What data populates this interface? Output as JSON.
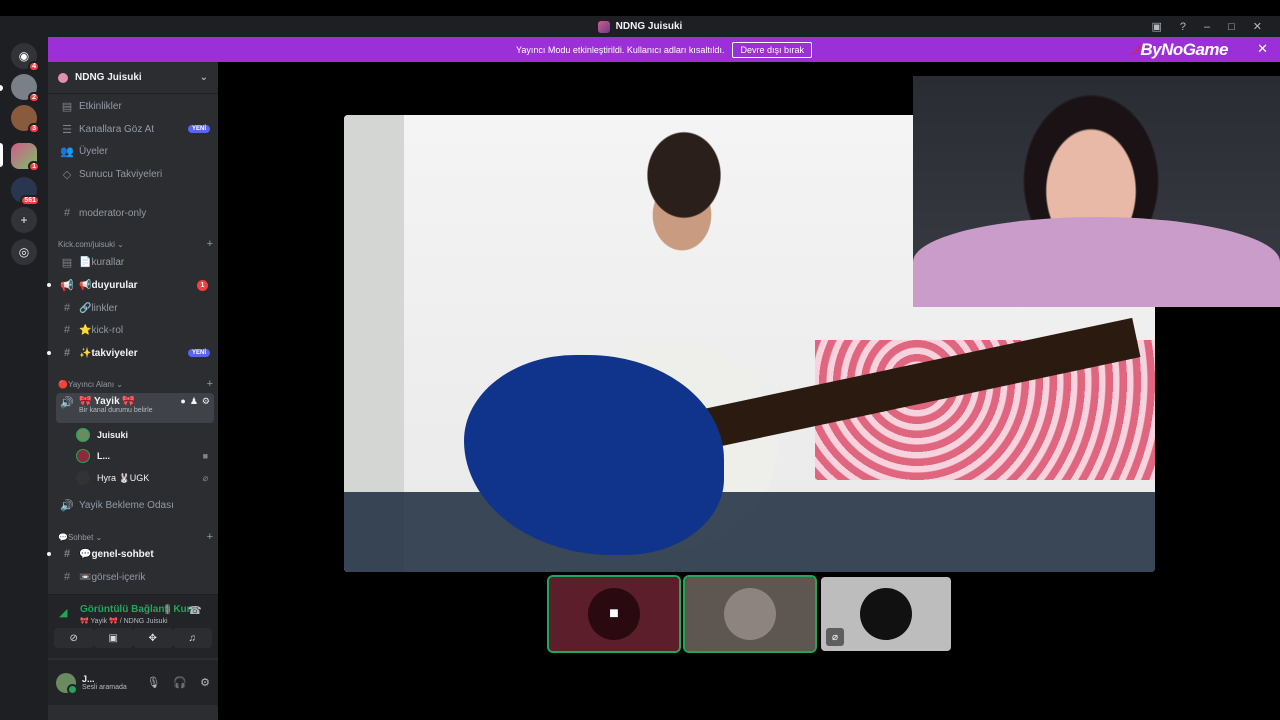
{
  "window": {
    "title": "NDNG Juisuki"
  },
  "banner": {
    "message": "Yayıncı Modu etkinleştirildi. Kullanıcı adları kısaltıldı.",
    "disable_label": "Devre dışı bırak",
    "brand": "ByNoGame"
  },
  "servers": {
    "badges": [
      "4",
      "2",
      "3",
      "1",
      "561"
    ]
  },
  "guild": {
    "name": "NDNG Juisuki",
    "top_items": [
      {
        "label": "Etkinlikler"
      },
      {
        "label": "Kanallara Göz At",
        "tag": "YENİ"
      },
      {
        "label": "Üyeler"
      },
      {
        "label": "Sunucu Takviyeleri"
      }
    ],
    "pinned_channel": "moderator-only",
    "categories": [
      {
        "name": "Kick.com/juisuki",
        "channels": [
          {
            "label": "📄kurallar"
          },
          {
            "label": "📢duyurular",
            "badge": "1"
          },
          {
            "label": "🔗linkler"
          },
          {
            "label": "⭐kick-rol"
          },
          {
            "label": "✨takviyeler",
            "tag": "YENİ"
          }
        ]
      },
      {
        "name": "🔴Yayıncı Alanı",
        "voice_channel": "🎀 Yayik 🎀",
        "voice_status": "Bir kanal durumu belirle",
        "voice_users": [
          "Juisuki",
          "L...",
          "Hyra 🐰UGK"
        ],
        "waiting_room": "Yayik Bekleme Odası"
      },
      {
        "name": "💬Sohbet",
        "channels": [
          {
            "label": "💬genel-sohbet"
          },
          {
            "label": "📼görsel-içerik"
          }
        ]
      }
    ]
  },
  "rtc": {
    "status": "Görüntülü Bağlantı Kuru",
    "location": "🎀 Yayik 🎀 / NDNG Juisuki"
  },
  "user_panel": {
    "name": "J...",
    "status": "Sesli aramada"
  }
}
